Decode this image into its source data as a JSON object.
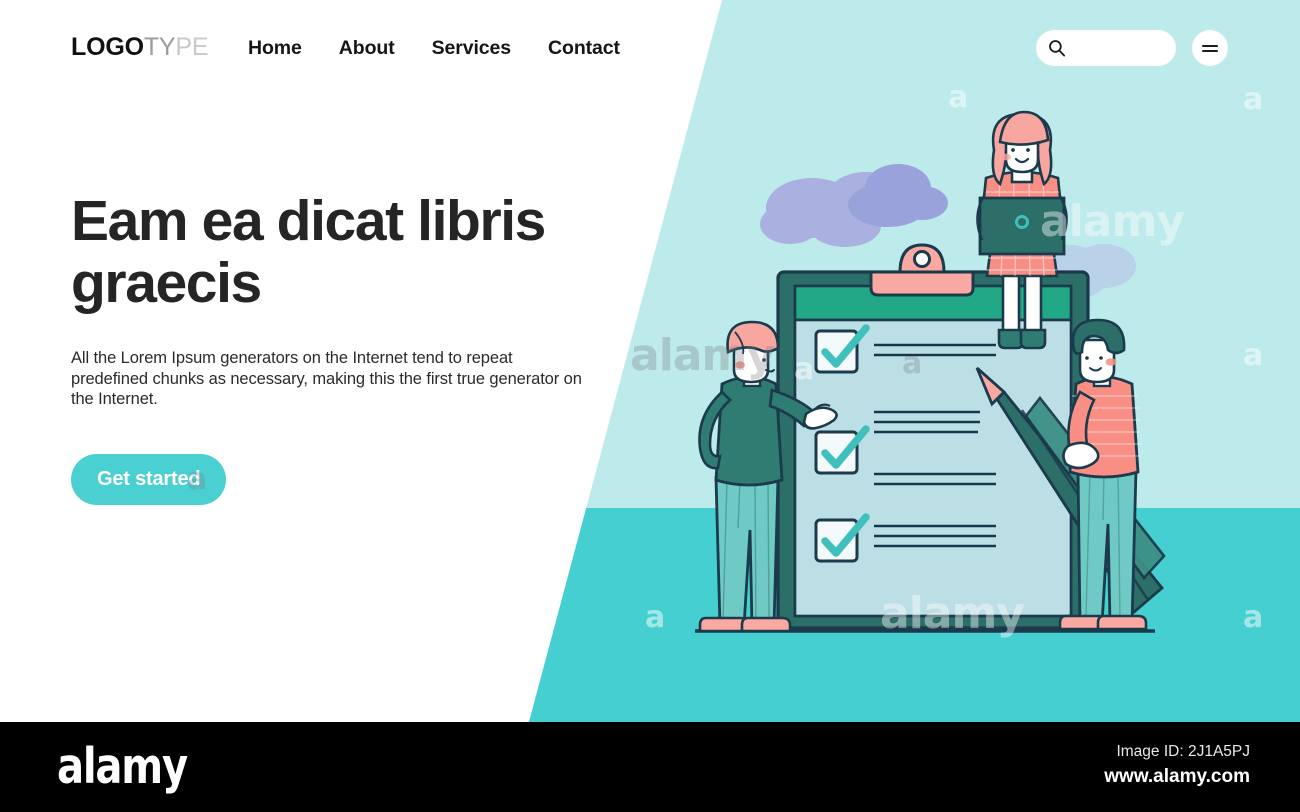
{
  "header": {
    "logo": {
      "bold_part": "LOGO",
      "light_part": "TY",
      "fade_part": "PE"
    },
    "nav": [
      {
        "label": "Home",
        "name": "nav-home"
      },
      {
        "label": "About",
        "name": "nav-about"
      },
      {
        "label": "Services",
        "name": "nav-services"
      },
      {
        "label": "Contact",
        "name": "nav-contact"
      }
    ],
    "search": {
      "placeholder": "",
      "value": "",
      "icon": "search-icon"
    },
    "menu": {
      "icon": "hamburger-menu-icon"
    }
  },
  "hero": {
    "headline": "Eam ea dicat libris graecis",
    "subcopy": "All the Lorem Ipsum generators on the Internet tend to repeat predefined chunks as necessary, making this the first true generator on the Internet.",
    "cta_label": "Get started"
  },
  "illustration": {
    "alt": "Two people and a woman with a laptop around a giant checklist clipboard",
    "checklist_items": 3,
    "characters": [
      {
        "name": "person-left-pointing",
        "hair": "#f7a6a0",
        "top": "#2f7d72",
        "pants": "#6fc9c4"
      },
      {
        "name": "person-top-laptop",
        "hair": "#f7a6a0",
        "dress": "#f98f84",
        "laptop": "#2b6f68"
      },
      {
        "name": "person-right-pencil",
        "hair": "#2b6f68",
        "top": "#f98f84",
        "pants": "#6fc9c4"
      }
    ]
  },
  "watermarks": {
    "letters": [
      "a",
      "a",
      "a",
      "a",
      "a",
      "a",
      "a",
      "a"
    ],
    "words": [
      "alamy",
      "alamy",
      "alamy"
    ]
  },
  "footer": {
    "brand": "alamy",
    "image_id": "Image ID: 2J1A5PJ",
    "url": "www.alamy.com"
  },
  "colors": {
    "sky": "#bdeaea",
    "ground": "#46cfd1",
    "accent": "#4bd0d2",
    "dark_teal": "#2b6f68",
    "green_band": "#23a886",
    "paper": "#bcdfe5",
    "pink": "#f9a9a2",
    "cloud": "#aab0e0",
    "outline": "#1b3a4b",
    "footer_bg": "#000000"
  }
}
